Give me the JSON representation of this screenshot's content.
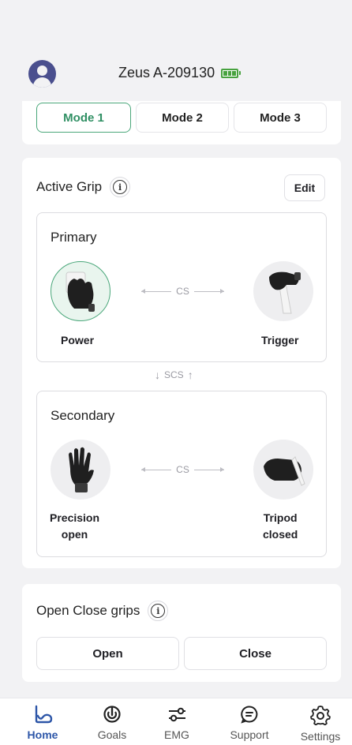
{
  "header": {
    "device_name": "Zeus A-209130"
  },
  "modes": [
    "Mode 1",
    "Mode 2",
    "Mode 3"
  ],
  "active_mode": "Mode 1",
  "active_grip": {
    "title": "Active Grip",
    "edit_label": "Edit",
    "primary": {
      "title": "Primary",
      "left_grip": "Power",
      "right_grip": "Trigger",
      "link_label": "CS"
    },
    "switch_label": "SCS",
    "secondary": {
      "title": "Secondary",
      "left_grip_line1": "Precision",
      "left_grip_line2": "open",
      "right_grip_line1": "Tripod",
      "right_grip_line2": "closed",
      "link_label": "CS"
    }
  },
  "open_close": {
    "title": "Open Close grips",
    "open_label": "Open",
    "close_label": "Close"
  },
  "nav": {
    "items": [
      {
        "label": "Home",
        "icon": "home-icon"
      },
      {
        "label": "Goals",
        "icon": "goals-icon"
      },
      {
        "label": "EMG",
        "icon": "emg-icon"
      },
      {
        "label": "Support",
        "icon": "support-icon"
      },
      {
        "label": "Settings",
        "icon": "settings-icon"
      }
    ],
    "active": "Home"
  },
  "colors": {
    "accent_green": "#4aa77a",
    "nav_active": "#2d56a8",
    "avatar": "#4a4f8e",
    "battery": "#48a23f"
  }
}
